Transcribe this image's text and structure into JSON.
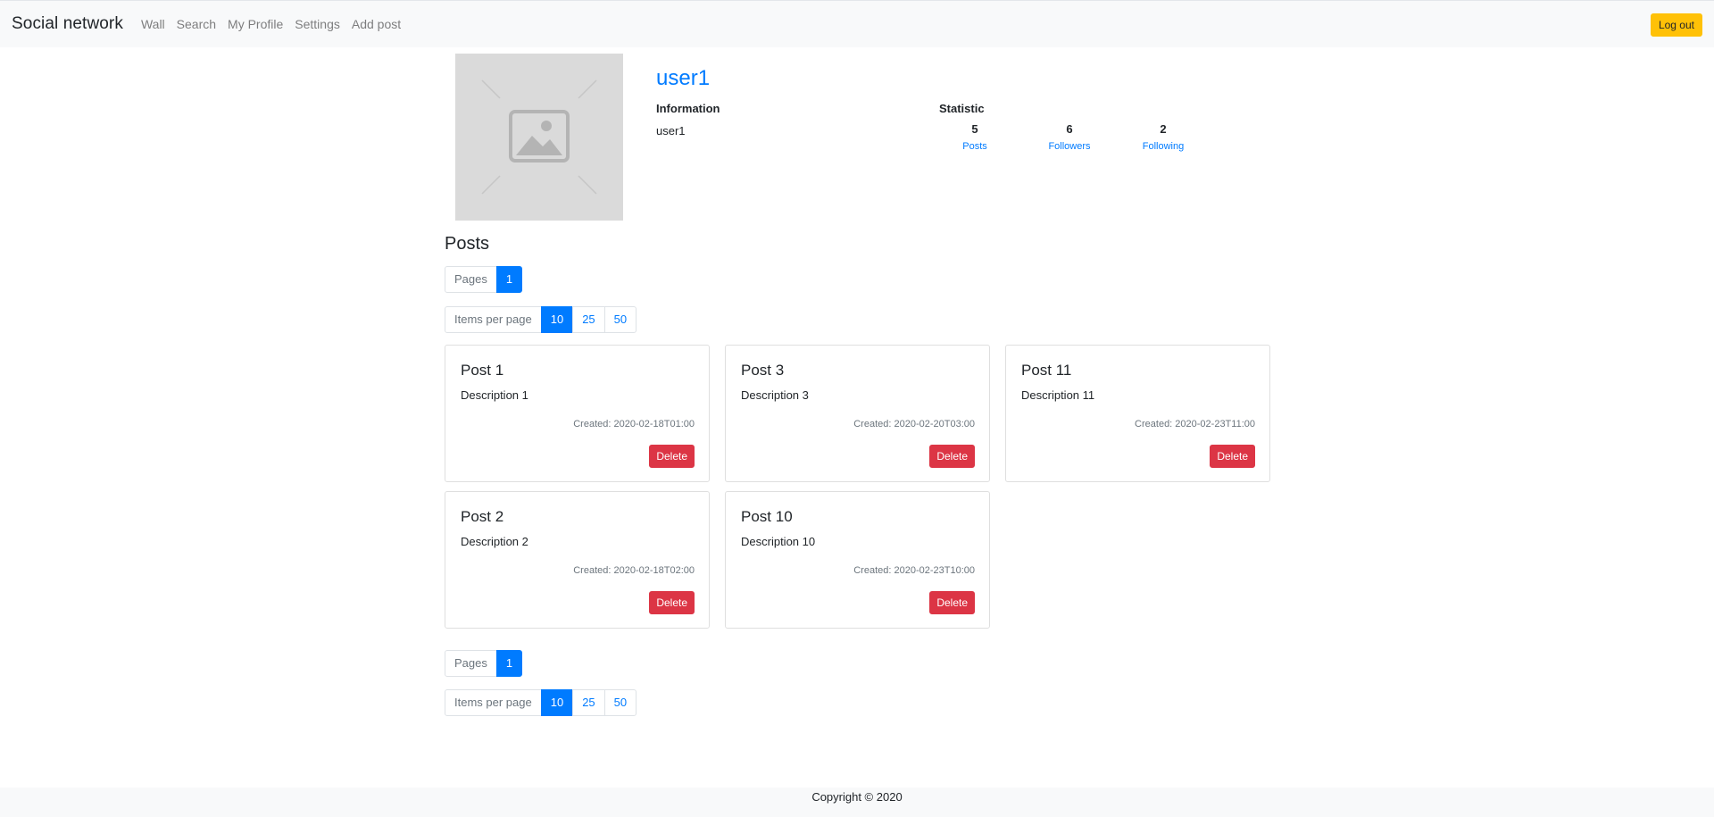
{
  "navbar": {
    "brand": "Social network",
    "links": [
      "Wall",
      "Search",
      "My Profile",
      "Settings",
      "Add post"
    ],
    "logout_label": "Log out"
  },
  "profile": {
    "username": "user1",
    "information_heading": "Information",
    "information_value": "user1",
    "statistic_heading": "Statistic",
    "stats": [
      {
        "value": "5",
        "label": "Posts"
      },
      {
        "value": "6",
        "label": "Followers"
      },
      {
        "value": "2",
        "label": "Following"
      }
    ]
  },
  "posts_section": {
    "title": "Posts",
    "pages_label": "Pages",
    "pages": [
      "1"
    ],
    "items_per_page_label": "Items per page",
    "items_per_page_options": [
      "10",
      "25",
      "50"
    ],
    "items_per_page_selected": "10"
  },
  "posts": [
    {
      "title": "Post 1",
      "description": "Description 1",
      "created": "Created: 2020-02-18T01:00",
      "delete_label": "Delete"
    },
    {
      "title": "Post 3",
      "description": "Description 3",
      "created": "Created: 2020-02-20T03:00",
      "delete_label": "Delete"
    },
    {
      "title": "Post 11",
      "description": "Description 11",
      "created": "Created: 2020-02-23T11:00",
      "delete_label": "Delete"
    },
    {
      "title": "Post 2",
      "description": "Description 2",
      "created": "Created: 2020-02-18T02:00",
      "delete_label": "Delete"
    },
    {
      "title": "Post 10",
      "description": "Description 10",
      "created": "Created: 2020-02-23T10:00",
      "delete_label": "Delete"
    }
  ],
  "footer": {
    "copyright": "Copyright © 2020"
  },
  "colors": {
    "primary": "#007bff",
    "danger": "#dc3545",
    "warning": "#ffc107",
    "light": "#f8f9fa"
  }
}
